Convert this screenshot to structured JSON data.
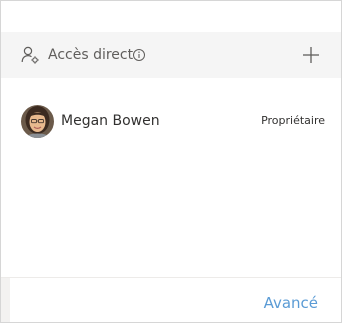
{
  "section": {
    "title": "Accès direct",
    "icon": "person-gear-icon",
    "info_icon": "info-icon",
    "add_icon": "plus-icon"
  },
  "members": [
    {
      "name": "Megan Bowen",
      "role": "Propriétaire",
      "avatar": "avatar-photo"
    }
  ],
  "footer": {
    "advanced_label": "Avancé"
  },
  "colors": {
    "header_background": "#f5f5f5",
    "link": "#5a9bd5",
    "text_primary": "#323130",
    "text_secondary": "#605e5c"
  }
}
